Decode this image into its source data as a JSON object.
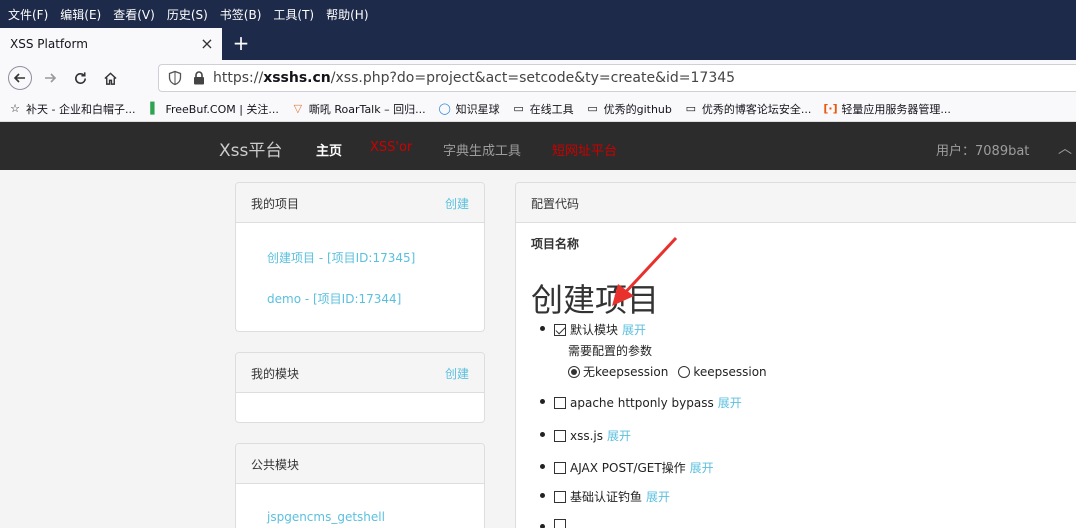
{
  "menubar": [
    "文件(F)",
    "编辑(E)",
    "查看(V)",
    "历史(S)",
    "书签(B)",
    "工具(T)",
    "帮助(H)"
  ],
  "tab": {
    "title": "XSS Platform",
    "close": "×",
    "new_tab": "+"
  },
  "url": {
    "prefix": "https://",
    "host": "xsshs.cn",
    "path": "/xss.php?do=project&act=setcode&ty=create&id=17345"
  },
  "bookmarks": [
    {
      "label": "补天 - 企业和白帽子...",
      "icon": "star-icon",
      "color": "#555555"
    },
    {
      "label": "FreeBuf.COM | 关注...",
      "icon": "freebuf-icon",
      "color": "#2ea44f"
    },
    {
      "label": "嘶吼 RoarTalk – 回归...",
      "icon": "roartalk-icon",
      "color": "#e07a3c"
    },
    {
      "label": "知识星球",
      "icon": "circle-icon",
      "color": "#2e86de"
    },
    {
      "label": "在线工具",
      "icon": "folder-icon",
      "color": "#555555"
    },
    {
      "label": "优秀的github",
      "icon": "folder-icon",
      "color": "#555555"
    },
    {
      "label": "优秀的博客论坛安全...",
      "icon": "folder-icon",
      "color": "#555555"
    },
    {
      "label": "轻量应用服务器管理...",
      "icon": "bracket-icon",
      "color": "#e8590c"
    }
  ],
  "site": {
    "brand": "Xss平台",
    "nav": [
      {
        "label": "主页",
        "color": "#ffffff"
      },
      {
        "label": "XSS'or",
        "color": "#cc0000"
      },
      {
        "label": "字典生成工具",
        "color": "#9d9d9d"
      },
      {
        "label": "短网址平台",
        "color": "#cc0000"
      }
    ],
    "user": "用户：7089bat"
  },
  "my_projects": {
    "title": "我的项目",
    "action": "创建",
    "items": [
      "创建项目 - [项目ID:17345]",
      "demo - [项目ID:17344]"
    ]
  },
  "my_modules": {
    "title": "我的模块",
    "action": "创建"
  },
  "public_modules": {
    "title": "公共模块",
    "items": [
      "jspgencms_getshell"
    ]
  },
  "config": {
    "title": "配置代码",
    "name_label": "项目名称",
    "project_title": "创建项目",
    "default_module": "默认模块",
    "expand": "展开",
    "params_label": "需要配置的参数",
    "radio_on": "无keepsession",
    "radio_off": "keepsession",
    "modules": [
      "apache httponly bypass",
      "xss.js",
      "AJAX POST/GET操作",
      "基础认证钓鱼"
    ]
  },
  "colors": {
    "link": "#5bc0de",
    "arrow": "#e8302c",
    "chrome_dark": "#1e2a4a"
  }
}
